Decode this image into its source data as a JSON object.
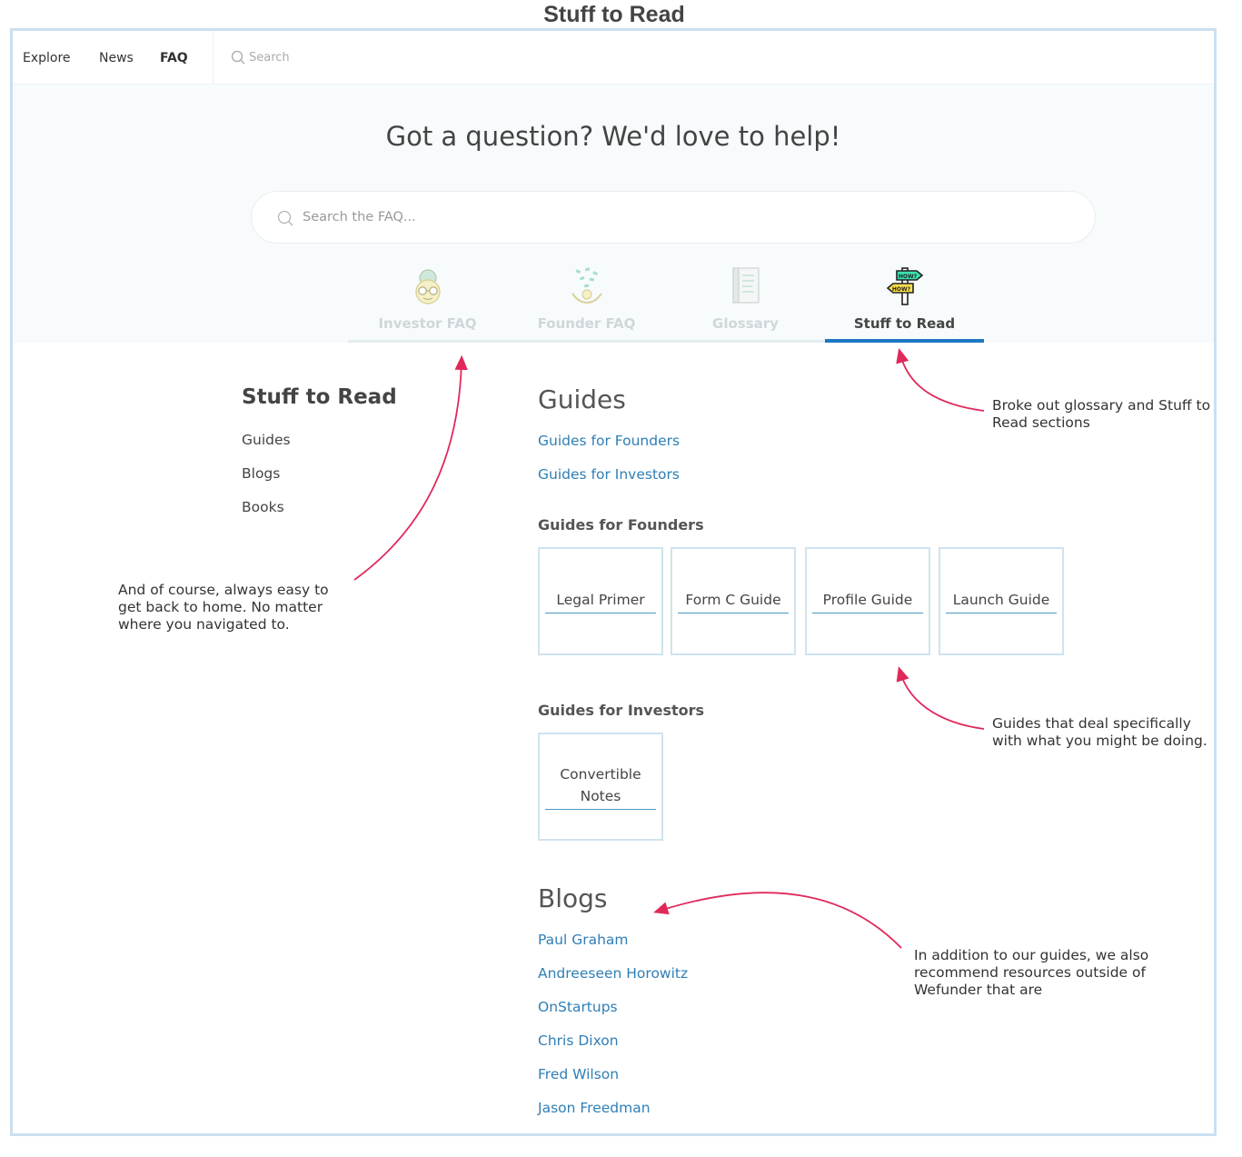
{
  "page_title": "Stuff to Read",
  "nav": {
    "explore": "Explore",
    "news": "News",
    "faq": "FAQ",
    "search_placeholder": "Search"
  },
  "hero": {
    "heading": "Got a question? We'd love to help!",
    "search_placeholder": "Search the FAQ..."
  },
  "tabs": [
    {
      "label": "Investor FAQ",
      "icon": "investor-icon",
      "active": false
    },
    {
      "label": "Founder FAQ",
      "icon": "founder-icon",
      "active": false
    },
    {
      "label": "Glossary",
      "icon": "book-icon",
      "active": false
    },
    {
      "label": "Stuff to Read",
      "icon": "signpost-icon",
      "active": true,
      "icon_text_top": "HOW?",
      "icon_text_bottom": "HOW?"
    }
  ],
  "sidebar": {
    "title": "Stuff to Read",
    "items": [
      "Guides",
      "Blogs",
      "Books"
    ]
  },
  "guides": {
    "title": "Guides",
    "links": [
      "Guides for Founders",
      "Guides for Investors"
    ],
    "founders_heading": "Guides for Founders",
    "founders_cards": [
      "Legal Primer",
      "Form C Guide",
      "Profile Guide",
      "Launch Guide"
    ],
    "investors_heading": "Guides for Investors",
    "investors_cards": [
      "Convertible Notes"
    ]
  },
  "blogs": {
    "title": "Blogs",
    "links": [
      "Paul Graham",
      "Andreeseen Horowitz",
      "OnStartups",
      "Chris Dixon",
      "Fred Wilson",
      "Jason Freedman"
    ]
  },
  "annotations": {
    "home": "And of course, always easy to get back to home. No matter where you navigated to.",
    "sections": "Broke out glossary and Stuff to Read sections",
    "guides": "Guides that deal specifically with what you might be doing.",
    "resources": "In addition to our guides, we also recommend resources outside of Wefunder that are"
  },
  "colors": {
    "accent": "#1f78c2",
    "link": "#2f7fb5",
    "annotation_arrow": "#e0295a",
    "frame_border": "#c9e0f1"
  }
}
